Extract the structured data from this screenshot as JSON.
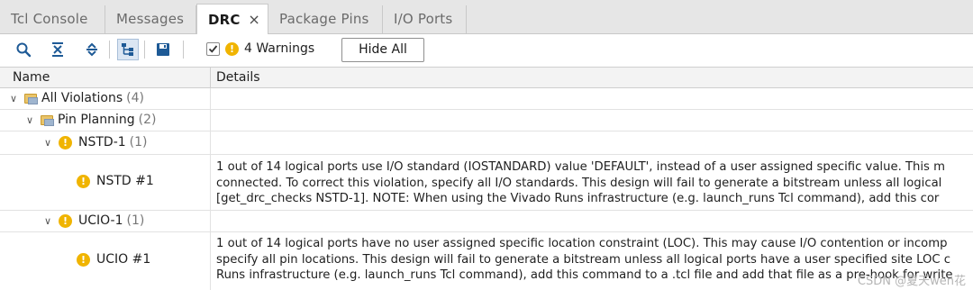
{
  "tabs": [
    {
      "label": "Tcl Console"
    },
    {
      "label": "Messages"
    },
    {
      "label": "DRC",
      "close": "×"
    },
    {
      "label": "Package Pins"
    },
    {
      "label": "I/O Ports"
    }
  ],
  "toolbar": {
    "icons": [
      "search-icon",
      "collapse-all-icon",
      "expand-all-icon",
      "hierarchy-icon",
      "save-icon"
    ],
    "warnings_checked": true,
    "warnings_label": "4 Warnings",
    "hide_all_label": "Hide All"
  },
  "table": {
    "columns": [
      "Name",
      "Details"
    ],
    "rows": [
      {
        "name": "All Violations",
        "count": "(4)"
      },
      {
        "name": "Pin Planning",
        "count": "(2)"
      },
      {
        "name": "NSTD-1",
        "count": "(1)"
      },
      {
        "name": "NSTD #1",
        "details": [
          "1 out of 14 logical ports use I/O standard (IOSTANDARD) value 'DEFAULT', instead of a user assigned specific value. This m",
          "connected. To correct this violation, specify all I/O standards. This design will fail to generate a bitstream unless all logical",
          "[get_drc_checks NSTD-1].  NOTE: When using the Vivado Runs infrastructure (e.g. launch_runs Tcl command), add this cor"
        ]
      },
      {
        "name": "UCIO-1",
        "count": "(1)"
      },
      {
        "name": "UCIO #1",
        "details": [
          "1 out of 14 logical ports have no user assigned specific location constraint (LOC). This may cause I/O contention or incomp",
          "specify all pin locations. This design will fail to generate a bitstream unless all logical ports have a user specified site LOC c",
          "Runs infrastructure (e.g. launch_runs Tcl command), add this command to a .tcl file and add that file as a pre-hook for write"
        ]
      }
    ]
  },
  "watermark": "CSDN @夏天wen花",
  "colors": {
    "warning": "#f0b400",
    "folder": "#e9c46a",
    "tab_bg": "#e6e6e6",
    "header_bg": "#f3f3f3"
  }
}
